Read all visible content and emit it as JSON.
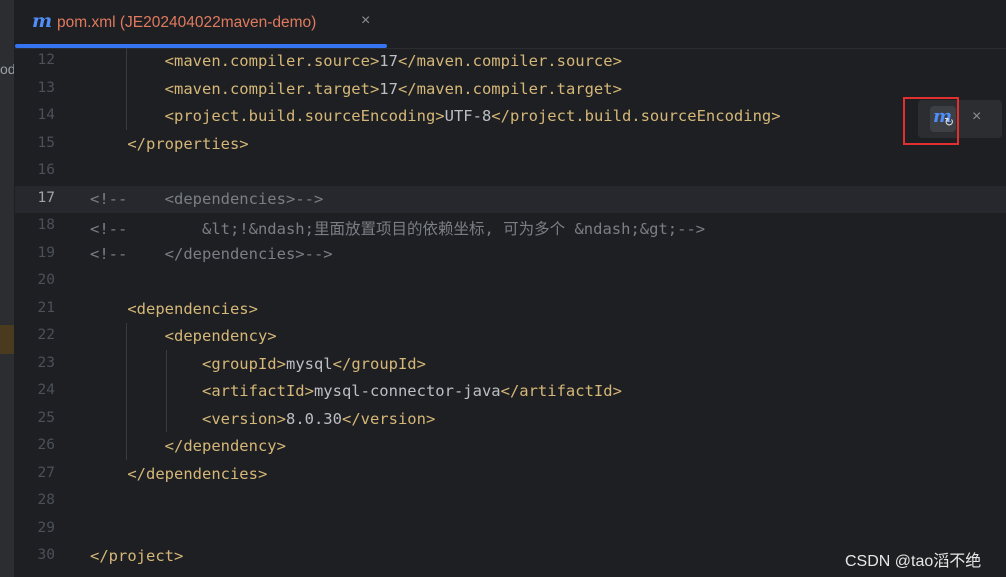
{
  "left_panel": {
    "fragment": "od"
  },
  "tab": {
    "icon": "maven-m-icon",
    "label": "pom.xml (JE202404022maven-demo)",
    "close": "×"
  },
  "sync_popup": {
    "icon": "maven-reload-icon",
    "glyph": "m",
    "refresh": "↻",
    "close": "×"
  },
  "editor": {
    "current_line": "17",
    "lines": [
      {
        "n": "12",
        "parts": [
          {
            "t": "        "
          },
          {
            "c": "tag",
            "t": "<maven.compiler.source>"
          },
          {
            "c": "txt",
            "t": "17"
          },
          {
            "c": "tag",
            "t": "</maven.compiler.source>"
          }
        ]
      },
      {
        "n": "13",
        "parts": [
          {
            "t": "        "
          },
          {
            "c": "tag",
            "t": "<maven.compiler.target>"
          },
          {
            "c": "txt",
            "t": "17"
          },
          {
            "c": "tag",
            "t": "</maven.compiler.target>"
          }
        ]
      },
      {
        "n": "14",
        "parts": [
          {
            "t": "        "
          },
          {
            "c": "tag",
            "t": "<project.build.sourceEncoding>"
          },
          {
            "c": "txt",
            "t": "UTF-8"
          },
          {
            "c": "tag",
            "t": "</project.build.sourceEncoding>"
          }
        ]
      },
      {
        "n": "15",
        "parts": [
          {
            "t": "    "
          },
          {
            "c": "tag",
            "t": "</properties>"
          }
        ]
      },
      {
        "n": "16",
        "parts": []
      },
      {
        "n": "17",
        "parts": [
          {
            "c": "cmt",
            "t": "<!--    <dependencies>-->"
          }
        ]
      },
      {
        "n": "18",
        "parts": [
          {
            "c": "cmt",
            "t": "<!--        &lt;!&ndash;里面放置项目的依赖坐标, 可为多个 &ndash;&gt;-->"
          }
        ]
      },
      {
        "n": "19",
        "parts": [
          {
            "c": "cmt",
            "t": "<!--    </dependencies>-->"
          }
        ]
      },
      {
        "n": "20",
        "parts": []
      },
      {
        "n": "21",
        "parts": [
          {
            "t": "    "
          },
          {
            "c": "tag",
            "t": "<dependencies>"
          }
        ]
      },
      {
        "n": "22",
        "parts": [
          {
            "t": "        "
          },
          {
            "c": "tag",
            "t": "<dependency>"
          }
        ]
      },
      {
        "n": "23",
        "parts": [
          {
            "t": "            "
          },
          {
            "c": "tag",
            "t": "<groupId>"
          },
          {
            "c": "txt",
            "t": "mysql"
          },
          {
            "c": "tag",
            "t": "</groupId>"
          }
        ]
      },
      {
        "n": "24",
        "parts": [
          {
            "t": "            "
          },
          {
            "c": "tag",
            "t": "<artifactId>"
          },
          {
            "c": "txt",
            "t": "mysql-connector-java"
          },
          {
            "c": "tag",
            "t": "</artifactId>"
          }
        ]
      },
      {
        "n": "25",
        "parts": [
          {
            "t": "            "
          },
          {
            "c": "tag",
            "t": "<version>"
          },
          {
            "c": "txt",
            "t": "8.0.30"
          },
          {
            "c": "tag",
            "t": "</version>"
          }
        ]
      },
      {
        "n": "26",
        "parts": [
          {
            "t": "        "
          },
          {
            "c": "tag",
            "t": "</dependency>"
          }
        ]
      },
      {
        "n": "27",
        "parts": [
          {
            "t": "    "
          },
          {
            "c": "tag",
            "t": "</dependencies>"
          }
        ]
      },
      {
        "n": "28",
        "parts": []
      },
      {
        "n": "29",
        "parts": []
      },
      {
        "n": "30",
        "parts": [
          {
            "c": "tag",
            "t": "</project>"
          }
        ]
      }
    ]
  },
  "watermark": "CSDN @tao滔不绝",
  "colors": {
    "tag": "#d5b778",
    "text": "#bcbec4",
    "comment": "#7a7e85",
    "tab_label": "#e07a5f",
    "accent": "#3574f0",
    "highlight_box": "#e0302f"
  }
}
